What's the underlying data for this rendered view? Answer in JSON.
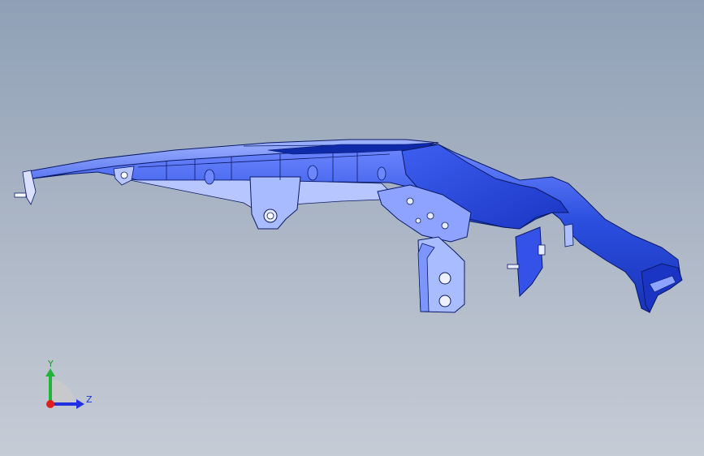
{
  "viewport": {
    "background_top": "#8fa0b6",
    "background_bottom": "#c6ccd6"
  },
  "model": {
    "primary_color": "#2c4fe0",
    "highlight_color": "#7f98ff",
    "edge_color": "#0a1a66",
    "bracket_color": "#aebfff"
  },
  "triad": {
    "y_label": "Y",
    "z_label": "Z",
    "y_color": "#22b33a",
    "z_color": "#2231e0",
    "x_color": "#e0201c"
  }
}
